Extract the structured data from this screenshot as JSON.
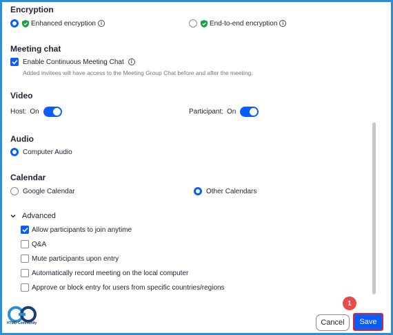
{
  "encryption": {
    "title": "Encryption",
    "enhanced_label": "Enhanced encryption",
    "e2e_label": "End-to-end encryption"
  },
  "meeting_chat": {
    "title": "Meeting chat",
    "enable_label": "Enable Continuous Meeting Chat",
    "description": "Added invitees will have access to the Meeting Group Chat before and after the meeting."
  },
  "video": {
    "title": "Video",
    "host_label": "Host:",
    "host_state": "On",
    "participant_label": "Participant:",
    "participant_state": "On"
  },
  "audio": {
    "title": "Audio",
    "option_label": "Computer Audio"
  },
  "calendar": {
    "title": "Calendar",
    "google_label": "Google Calendar",
    "other_label": "Other Calendars"
  },
  "advanced": {
    "title": "Advanced",
    "options": [
      "Allow participants to join anytime",
      "Q&A",
      "Mute participants upon entry",
      "Automatically record meeting on the local computer",
      "Approve or block entry for users from specific countries/regions"
    ]
  },
  "footer": {
    "cancel_label": "Cancel",
    "save_label": "Save",
    "step_badge": "1",
    "logo_text": "HTMD Community"
  },
  "colors": {
    "accent": "#0b5cff",
    "frame": "#2a8fd6",
    "highlight": "#d5252f",
    "shield": "#1e9d4a"
  }
}
